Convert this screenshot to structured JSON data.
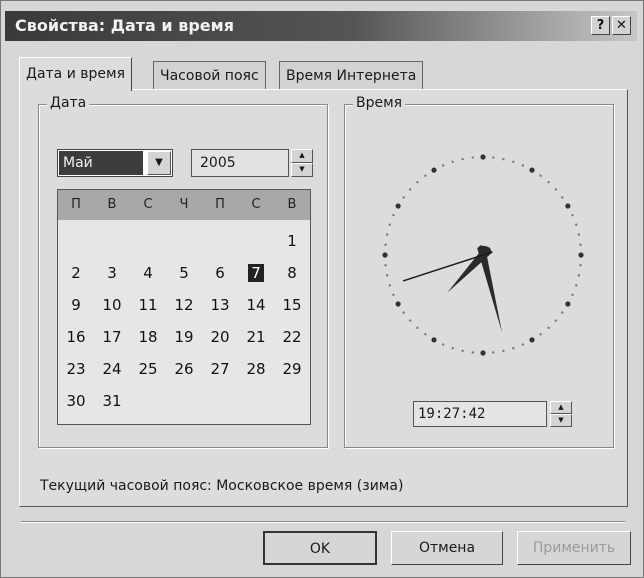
{
  "window": {
    "title": "Свойства: Дата и время",
    "help_label": "?",
    "close_label": "✕"
  },
  "tabs": [
    {
      "label": "Дата и время"
    },
    {
      "label": "Часовой пояс"
    },
    {
      "label": "Время Интернета"
    }
  ],
  "date_group": {
    "label": "Дата",
    "month": "Май",
    "year": "2005",
    "weekdays": [
      "П",
      "В",
      "С",
      "Ч",
      "П",
      "С",
      "В"
    ],
    "days": [
      "1",
      "2",
      "3",
      "4",
      "5",
      "6",
      "7",
      "8",
      "9",
      "10",
      "11",
      "12",
      "13",
      "14",
      "15",
      "16",
      "17",
      "18",
      "19",
      "20",
      "21",
      "22",
      "23",
      "24",
      "25",
      "26",
      "27",
      "28",
      "29",
      "30",
      "31"
    ],
    "selected_day": 7
  },
  "time_group": {
    "label": "Время",
    "time": "19:27:42"
  },
  "timezone_text": "Текущий часовой пояс: Московское время (зима)",
  "buttons": {
    "ok": "OK",
    "cancel": "Отмена",
    "apply": "Применить"
  },
  "icons": {
    "dropdown": "chevron-down-icon",
    "spin_up": "arrow-up-icon",
    "spin_down": "arrow-down-icon"
  }
}
